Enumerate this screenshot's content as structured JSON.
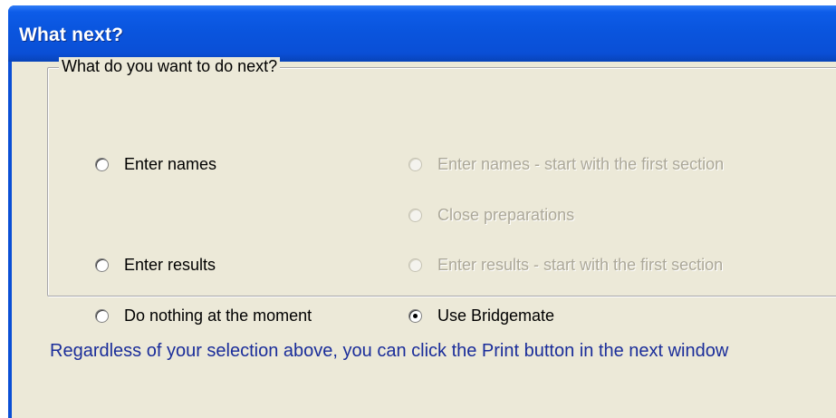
{
  "window": {
    "title": "What next?"
  },
  "group": {
    "legend": "What do you want to do next?",
    "options": [
      {
        "label": "Enter names",
        "enabled": true,
        "checked": false
      },
      {
        "label": "Enter names - start with the first section",
        "enabled": false,
        "checked": false
      },
      {
        "label": "Close preparations",
        "enabled": false,
        "checked": false
      },
      {
        "label": "Enter results",
        "enabled": true,
        "checked": false
      },
      {
        "label": "Enter results - start with the first section",
        "enabled": false,
        "checked": false
      },
      {
        "label": "Do nothing at the moment",
        "enabled": true,
        "checked": false
      },
      {
        "label": "Use Bridgemate",
        "enabled": true,
        "checked": true
      }
    ]
  },
  "info": {
    "text": "Regardless of your selection above, you can click the Print button in the next window"
  },
  "colors": {
    "titlebar": "#0a55de",
    "client_background": "#ece9d8",
    "disabled_text": "#aca899",
    "info_text": "#1a2d9a"
  },
  "icons": {
    "radio_unchecked": "radio-unchecked-icon",
    "radio_checked": "radio-checked-icon"
  }
}
